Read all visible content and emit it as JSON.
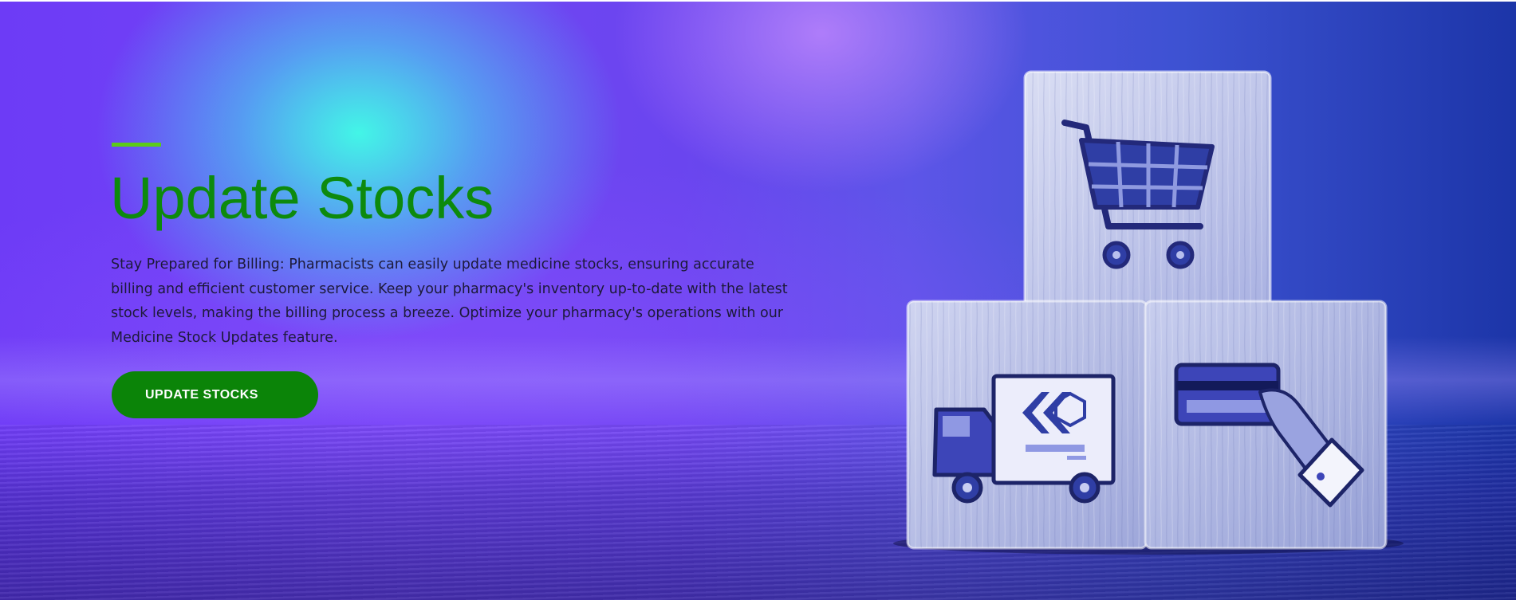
{
  "hero": {
    "title": "Update Stocks",
    "description": "Stay Prepared for Billing: Pharmacists can easily update medicine stocks, ensuring accurate billing and efficient customer service. Keep your pharmacy's inventory up-to-date with the latest stock levels, making the billing process a breeze. Optimize your pharmacy's operations with our Medicine Stock Updates feature.",
    "cta_label": "UPDATE STOCKS"
  },
  "illustration": {
    "blocks": [
      {
        "icon": "shopping-cart-icon"
      },
      {
        "icon": "delivery-truck-icon"
      },
      {
        "icon": "card-payment-icon"
      }
    ]
  },
  "colors": {
    "title_green": "#0d8a0d",
    "accent_bar_green": "#5ccb19",
    "button_green": "#0b8408",
    "button_text": "#ffffff",
    "body_text": "#1d1a3a",
    "background_purple": "#6d3bf6",
    "background_cyan": "#40ffe6",
    "background_navy": "#1c35a8"
  }
}
